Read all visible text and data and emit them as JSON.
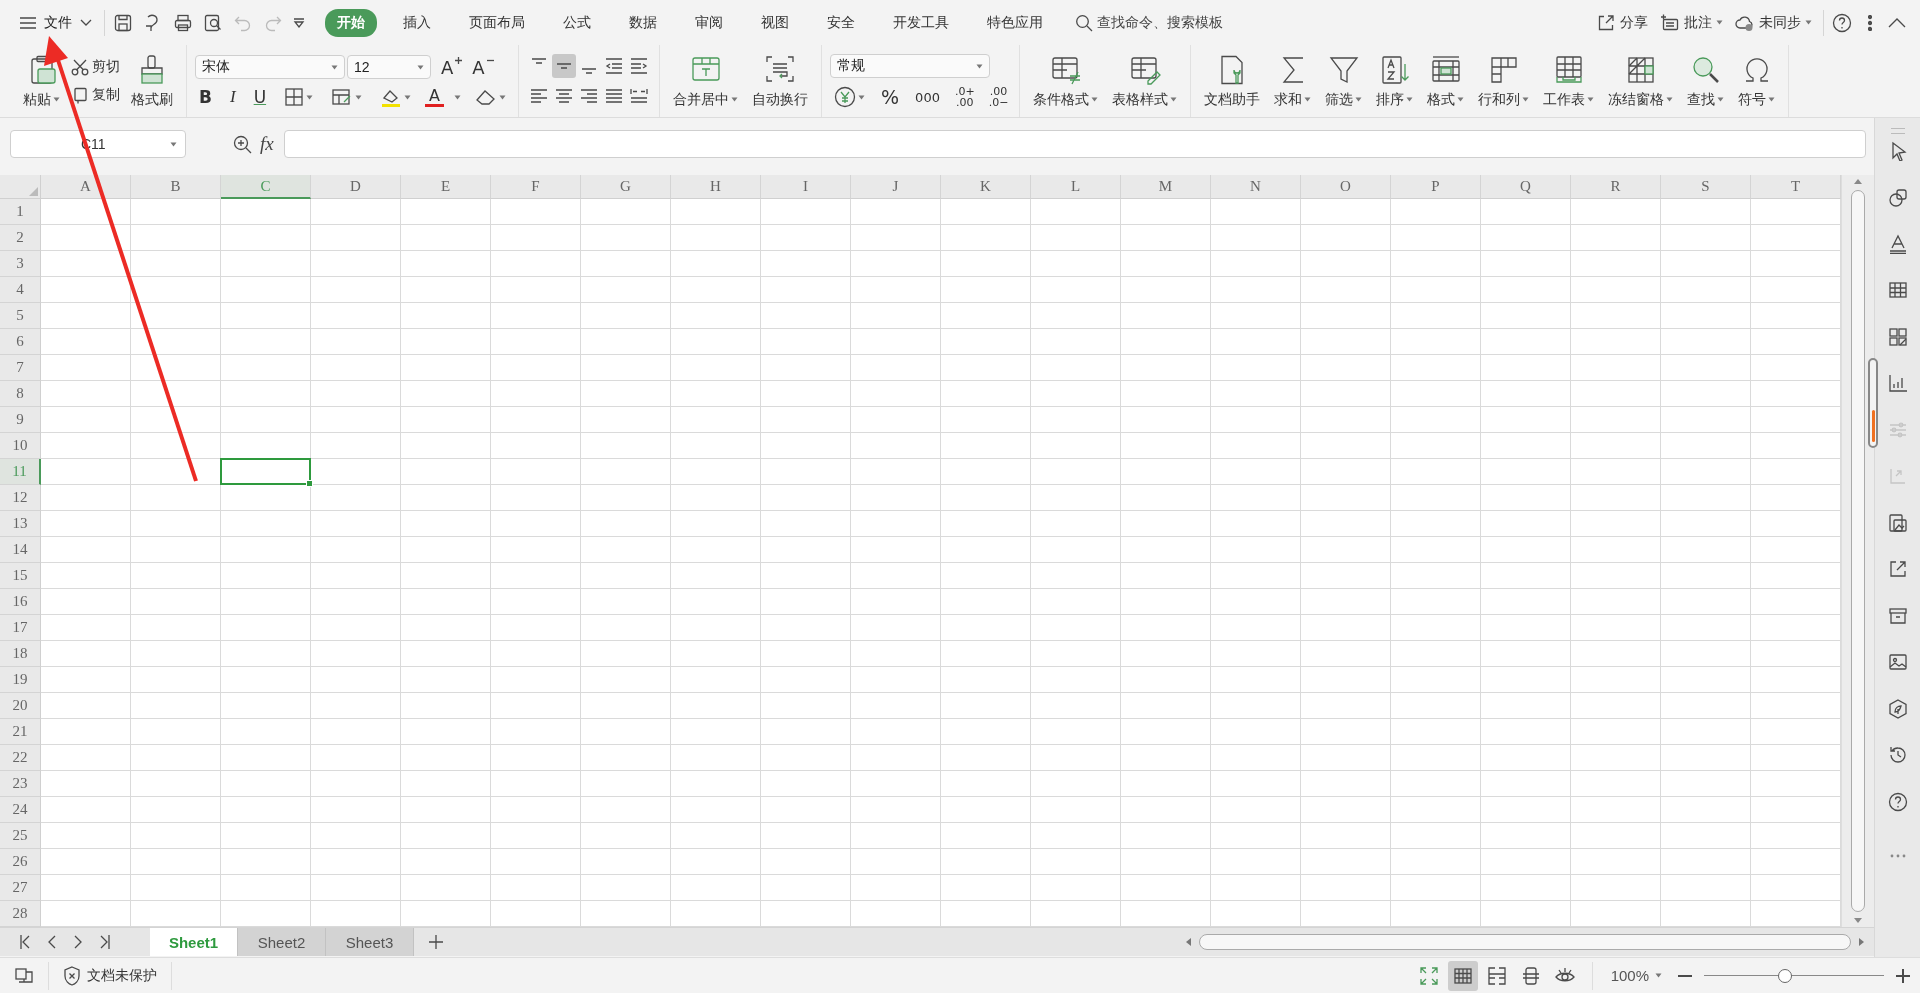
{
  "menu_bar": {
    "file_menu": "文件",
    "quick_access": [
      {
        "disabled": false
      },
      {
        "disabled": false
      },
      {
        "disabled": false
      },
      {
        "disabled": false
      },
      {
        "disabled": true
      },
      {
        "disabled": true
      }
    ],
    "tabs": [
      {
        "label": "开始",
        "selected": true
      },
      {
        "label": "插入",
        "selected": false
      },
      {
        "label": "页面布局",
        "selected": false
      },
      {
        "label": "公式",
        "selected": false
      },
      {
        "label": "数据",
        "selected": false
      },
      {
        "label": "审阅",
        "selected": false
      },
      {
        "label": "视图",
        "selected": false
      },
      {
        "label": "安全",
        "selected": false
      },
      {
        "label": "开发工具",
        "selected": false
      },
      {
        "label": "特色应用",
        "selected": false
      }
    ],
    "search": {
      "placeholder": "查找命令、搜索模板"
    },
    "actions": [
      {
        "label": "分享",
        "dropdown": false
      },
      {
        "label": "批注",
        "dropdown": true
      },
      {
        "label": "未同步",
        "dropdown": true
      }
    ]
  },
  "ribbon": {
    "clipboard": [
      {
        "label": "粘贴",
        "dropdown": true
      },
      {
        "label": "剪切",
        "dropdown": false
      },
      {
        "label": "复制",
        "dropdown": false
      },
      {
        "label": "格式刷",
        "dropdown": false
      }
    ],
    "font": {
      "name": "宋体",
      "size": "12",
      "grow": "A",
      "shrink": "A",
      "style_buttons": [
        "B",
        "I",
        "U"
      ],
      "color_button": "A"
    },
    "alignment_buttons": [
      {
        "selected": false
      },
      {
        "selected": true
      },
      {
        "selected": false
      },
      {
        "selected": false
      },
      {
        "selected": false
      },
      {
        "selected": false
      },
      {
        "selected": false
      },
      {
        "selected": false
      },
      {
        "selected": false
      },
      {
        "selected": false
      }
    ],
    "merge_group": [
      {
        "label": "合并居中",
        "dropdown": true
      },
      {
        "label": "自动换行",
        "dropdown": false
      }
    ],
    "number": {
      "format": "常规",
      "symbols": [
        "%",
        "000"
      ],
      "decimal_buttons": [
        {
          "top": ".0+",
          "bottom": ".00"
        },
        {
          "top": ".00",
          "bottom": ".0−"
        }
      ]
    },
    "style_group": [
      {
        "label": "条件格式",
        "dropdown": true
      },
      {
        "label": "表格样式",
        "dropdown": true
      }
    ],
    "tools_group": [
      {
        "label": "文档助手",
        "dropdown": false
      },
      {
        "label": "求和",
        "dropdown": true
      },
      {
        "label": "筛选",
        "dropdown": true
      },
      {
        "label": "排序",
        "dropdown": true
      },
      {
        "label": "格式",
        "dropdown": true
      },
      {
        "label": "行和列",
        "dropdown": true
      },
      {
        "label": "工作表",
        "dropdown": true
      },
      {
        "label": "冻结窗格",
        "dropdown": true
      },
      {
        "label": "查找",
        "dropdown": true
      },
      {
        "label": "符号",
        "dropdown": true
      }
    ]
  },
  "formula_bar": {
    "name_box": "C11",
    "function_label": "fx"
  },
  "grid": {
    "columns": [
      {
        "label": "A",
        "selected": false
      },
      {
        "label": "B",
        "selected": false
      },
      {
        "label": "C",
        "selected": true
      },
      {
        "label": "D",
        "selected": false
      },
      {
        "label": "E",
        "selected": false
      },
      {
        "label": "F",
        "selected": false
      },
      {
        "label": "G",
        "selected": false
      },
      {
        "label": "H",
        "selected": false
      },
      {
        "label": "I",
        "selected": false
      },
      {
        "label": "J",
        "selected": false
      },
      {
        "label": "K",
        "selected": false
      },
      {
        "label": "L",
        "selected": false
      },
      {
        "label": "M",
        "selected": false
      },
      {
        "label": "N",
        "selected": false
      },
      {
        "label": "O",
        "selected": false
      },
      {
        "label": "P",
        "selected": false
      },
      {
        "label": "Q",
        "selected": false
      },
      {
        "label": "R",
        "selected": false
      },
      {
        "label": "S",
        "selected": false
      },
      {
        "label": "T",
        "selected": false
      }
    ],
    "rows": [
      {
        "label": "1",
        "selected": false
      },
      {
        "label": "2",
        "selected": false
      },
      {
        "label": "3",
        "selected": false
      },
      {
        "label": "4",
        "selected": false
      },
      {
        "label": "5",
        "selected": false
      },
      {
        "label": "6",
        "selected": false
      },
      {
        "label": "7",
        "selected": false
      },
      {
        "label": "8",
        "selected": false
      },
      {
        "label": "9",
        "selected": false
      },
      {
        "label": "10",
        "selected": false
      },
      {
        "label": "11",
        "selected": true
      },
      {
        "label": "12",
        "selected": false
      },
      {
        "label": "13",
        "selected": false
      },
      {
        "label": "14",
        "selected": false
      },
      {
        "label": "15",
        "selected": false
      },
      {
        "label": "16",
        "selected": false
      },
      {
        "label": "17",
        "selected": false
      },
      {
        "label": "18",
        "selected": false
      },
      {
        "label": "19",
        "selected": false
      },
      {
        "label": "20",
        "selected": false
      },
      {
        "label": "21",
        "selected": false
      },
      {
        "label": "22",
        "selected": false
      },
      {
        "label": "23",
        "selected": false
      },
      {
        "label": "24",
        "selected": false
      },
      {
        "label": "25",
        "selected": false
      },
      {
        "label": "26",
        "selected": false
      },
      {
        "label": "27",
        "selected": false
      },
      {
        "label": "28",
        "selected": false
      }
    ]
  },
  "sheet_tabs": [
    {
      "label": "Sheet1",
      "selected": true
    },
    {
      "label": "Sheet2",
      "selected": false
    },
    {
      "label": "Sheet3",
      "selected": false
    }
  ],
  "side_panel": [
    {
      "disabled": false
    },
    {
      "disabled": false
    },
    {
      "disabled": false
    },
    {
      "disabled": false
    },
    {
      "disabled": false
    },
    {
      "disabled": false
    },
    {
      "disabled": true
    },
    {
      "disabled": true
    },
    {
      "disabled": false
    },
    {
      "disabled": false
    },
    {
      "disabled": false
    },
    {
      "disabled": false
    },
    {
      "disabled": false
    },
    {
      "disabled": false
    },
    {
      "disabled": false
    }
  ],
  "status_bar": {
    "protection": "文档未保护",
    "view_modes": [
      {
        "selected": false
      },
      {
        "selected": true
      },
      {
        "selected": false
      },
      {
        "selected": false
      },
      {
        "selected": false
      }
    ],
    "zoom": "100%",
    "zoom_slider": {
      "level": 0.45
    }
  },
  "annotation": {
    "kind": "arrow"
  }
}
